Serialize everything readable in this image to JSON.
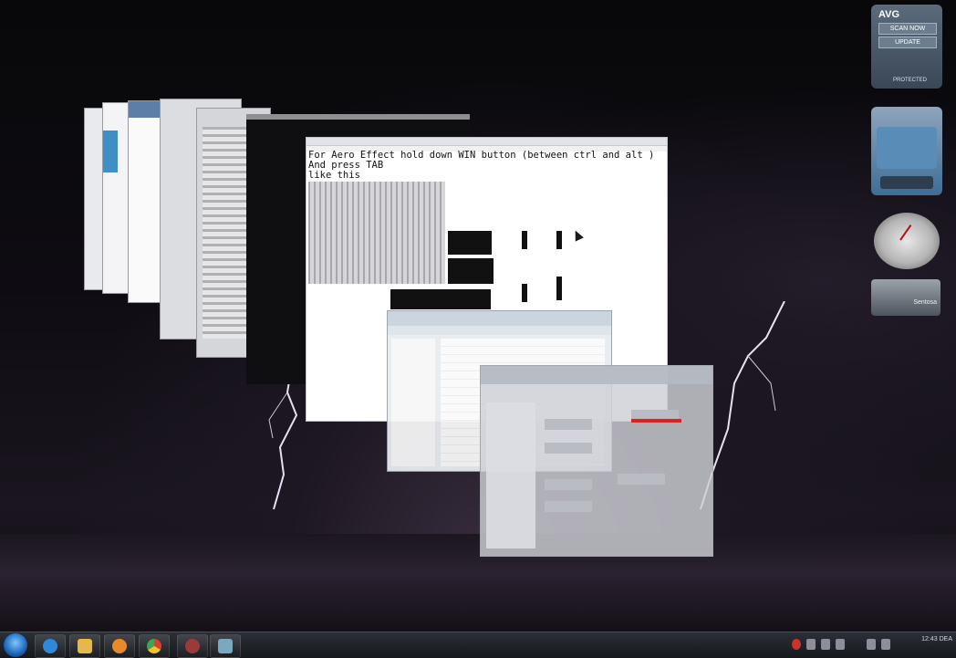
{
  "main_window": {
    "lines": [
      "For Aero Effect hold down WIN button (between ctrl and alt )",
      "And press TAB",
      "like this"
    ]
  },
  "gadgets": {
    "avg": {
      "logo": "AVG",
      "scan_label": "SCAN NOW",
      "update_label": "UPDATE",
      "status": "PROTECTED"
    },
    "slideshow": {
      "label": "Sentosa"
    }
  },
  "taskbar": {
    "items": [
      {
        "name": "internet-explorer",
        "color": "#2f88d8"
      },
      {
        "name": "windows-explorer",
        "color": "#e6b84a"
      },
      {
        "name": "media-player",
        "color": "#e98a2a"
      },
      {
        "name": "chrome",
        "color": "#d9412f"
      },
      {
        "name": "paint",
        "color": "#9a3a3a"
      },
      {
        "name": "notepad",
        "color": "#7aa8c0"
      }
    ],
    "clock": {
      "time": "12:43 DEA",
      "date": ""
    }
  },
  "colors": {
    "desktop": "#070709",
    "lightning": "#e8e0f0",
    "explorer_blue": "#3f8fc7"
  }
}
